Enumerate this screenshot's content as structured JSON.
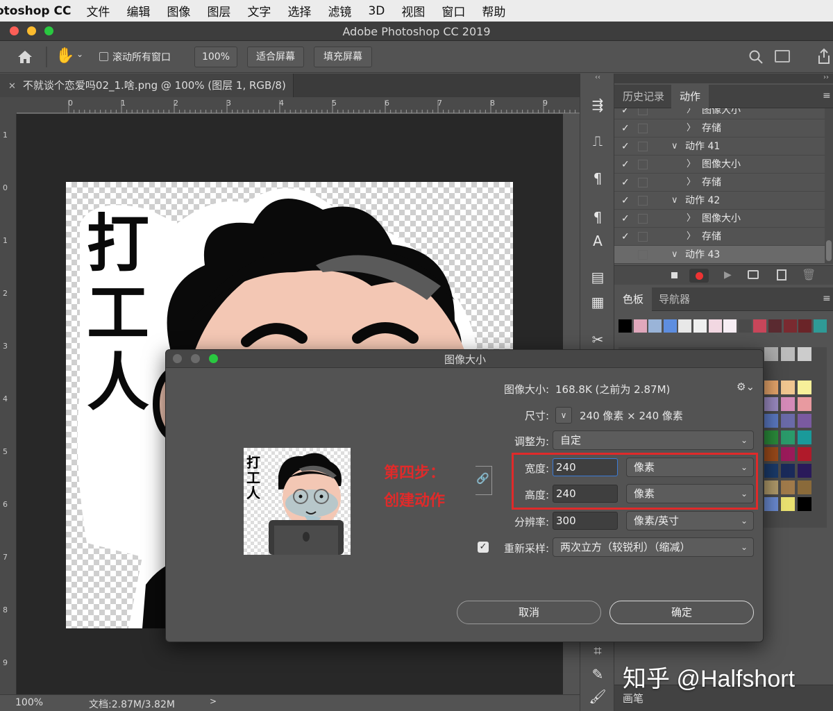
{
  "menubar": {
    "app": "otoshop CC",
    "items": [
      "文件",
      "编辑",
      "图像",
      "图层",
      "文字",
      "选择",
      "滤镜",
      "3D",
      "视图",
      "窗口",
      "帮助"
    ]
  },
  "window": {
    "title": "Adobe Photoshop CC 2019"
  },
  "options": {
    "scroll_all": "滚动所有窗口",
    "zoom": "100%",
    "fit_screen": "适合屏幕",
    "fill_screen": "填充屏幕"
  },
  "document": {
    "tab_title": "不就谈个恋爱吗02_1.啥.png @ 100% (图层 1, RGB/8)",
    "ruler_h": [
      "0",
      "1",
      "2",
      "3",
      "4",
      "5",
      "6",
      "7",
      "8",
      "9"
    ],
    "ruler_v": [
      "1",
      "0",
      "1",
      "2",
      "3",
      "4",
      "5",
      "6",
      "7",
      "8",
      "9"
    ],
    "sticker_text": [
      "打",
      "工",
      "人"
    ]
  },
  "status": {
    "zoom": "100%",
    "doc": "文档:2.87M/3.82M"
  },
  "history_panel": {
    "tabs": [
      "历史记录",
      "动作"
    ],
    "rows": [
      {
        "label": "图像大小",
        "level": 2,
        "checked": true,
        "partial": true
      },
      {
        "label": "存储",
        "level": 2,
        "checked": true
      },
      {
        "label": "动作 41",
        "level": 1,
        "checked": true
      },
      {
        "label": "图像大小",
        "level": 2,
        "checked": true
      },
      {
        "label": "存储",
        "level": 2,
        "checked": true
      },
      {
        "label": "动作 42",
        "level": 1,
        "checked": true
      },
      {
        "label": "图像大小",
        "level": 2,
        "checked": true
      },
      {
        "label": "存储",
        "level": 2,
        "checked": true
      },
      {
        "label": "动作 43",
        "level": 1,
        "checked": false,
        "selected": true
      }
    ]
  },
  "swatches_panel": {
    "tabs": [
      "色板",
      "导航器"
    ],
    "colors": [
      "#000000",
      "#e0a8bc",
      "#9ab4d8",
      "#5e8ee0",
      "#e8e8e8",
      "#f0f0f0",
      "#f2d8e2",
      "#f7eef4",
      "#4a4a4a",
      "#c8465a",
      "#5a2a30",
      "#7a2a30",
      "#6a2428",
      "#2f9a96"
    ]
  },
  "brush_panel": {
    "title": "画笔"
  },
  "dialog": {
    "title": "图像大小",
    "image_size_label": "图像大小:",
    "image_size_value": "168.8K (之前为 2.87M)",
    "dimensions_label": "尺寸:",
    "dimensions_value": "240 像素  ×  240 像素",
    "fit_label": "调整为:",
    "fit_value": "自定",
    "width_label": "宽度:",
    "width_value": "240",
    "width_unit": "像素",
    "height_label": "高度:",
    "height_value": "240",
    "height_unit": "像素",
    "resolution_label": "分辨率:",
    "resolution_value": "300",
    "resolution_unit": "像素/英寸",
    "resample_label": "重新采样:",
    "resample_value": "两次立方（较锐利）（缩减）",
    "cancel": "取消",
    "ok": "确定",
    "annotation": [
      "第四步：",
      "创建动作"
    ]
  },
  "watermark": "知乎 @Halfshort",
  "colors": {
    "accent_red": "#e02a2a",
    "bg": "#535353"
  }
}
